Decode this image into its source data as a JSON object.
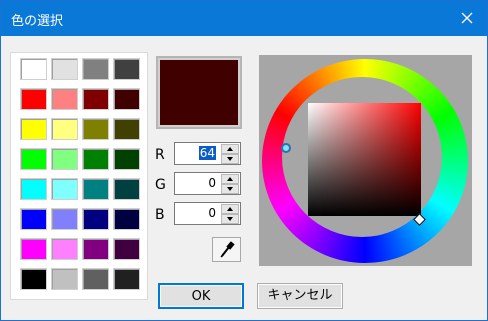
{
  "window": {
    "title": "色の選択"
  },
  "swatches": [
    "#ffffff",
    "#e1e1e1",
    "#808080",
    "#404040",
    "#ff0000",
    "#ff8080",
    "#800000",
    "#400000",
    "#ffff00",
    "#ffff80",
    "#808000",
    "#404000",
    "#00ff00",
    "#80ff80",
    "#008000",
    "#004000",
    "#00ffff",
    "#80ffff",
    "#008080",
    "#004040",
    "#0000ff",
    "#8080ff",
    "#000080",
    "#000040",
    "#ff00ff",
    "#ff80ff",
    "#800080",
    "#400040",
    "#000000",
    "#c0c0c0",
    "#606060",
    "#202020"
  ],
  "current_color": "#400000",
  "rgb": {
    "r_label": "R",
    "r_value": "64",
    "g_label": "G",
    "g_value": "0",
    "b_label": "B",
    "b_value": "0"
  },
  "buttons": {
    "ok": "OK",
    "cancel": "キャンセル"
  },
  "icons": {
    "close": "close-icon",
    "eyedropper": "eyedropper-icon"
  }
}
